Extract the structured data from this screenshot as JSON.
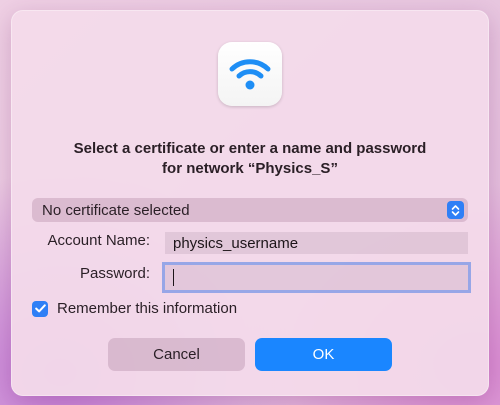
{
  "dialog": {
    "icon": "wifi-icon",
    "title_line1": "Select a certificate or enter a name and password",
    "title_line2": "for network “Physics_S”",
    "certificate_popup": {
      "selected": "No certificate selected",
      "icon": "popup-arrows-icon"
    },
    "account_name": {
      "label": "Account Name:",
      "value": "physics_username"
    },
    "password": {
      "label": "Password:",
      "value": ""
    },
    "remember": {
      "label": "Remember this information",
      "checked": true
    },
    "buttons": {
      "cancel_label": "Cancel",
      "ok_label": "OK"
    }
  },
  "colors": {
    "accent": "#2f7ff6",
    "ok_button": "#1a86ff",
    "wifi_icon": "#1e8ef5"
  }
}
